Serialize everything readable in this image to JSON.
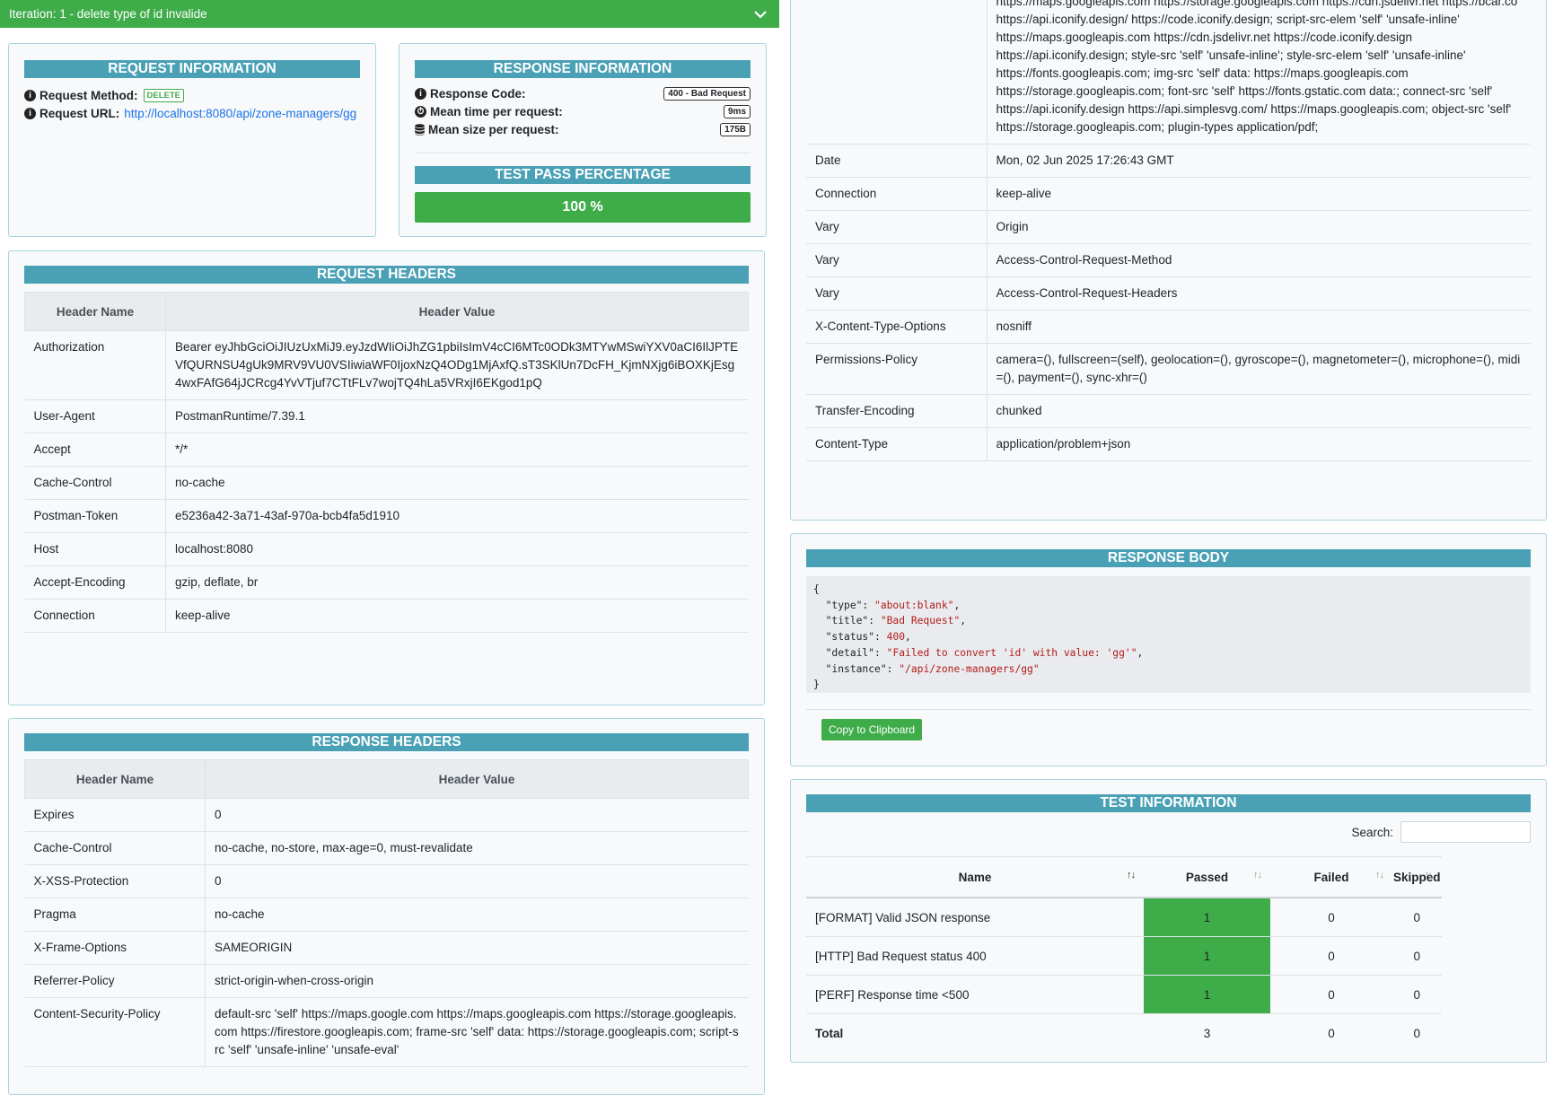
{
  "iteration": {
    "label": "Iteration: 1 - delete type of id invalide"
  },
  "request_info": {
    "title": "REQUEST INFORMATION",
    "method_label": "Request Method:",
    "method_value": "DELETE",
    "url_label": "Request URL:",
    "url_value": "http://localhost:8080/api/zone-managers/gg"
  },
  "response_info": {
    "title": "RESPONSE INFORMATION",
    "code_label": "Response Code:",
    "code_value": "400 - Bad Request",
    "time_label": "Mean time per request:",
    "time_value": "9ms",
    "size_label": "Mean size per request:",
    "size_value": "175B",
    "pass_title": "TEST PASS PERCENTAGE",
    "pass_value": "100 %",
    "pass_fraction": 1.0
  },
  "request_headers": {
    "title": "REQUEST HEADERS",
    "col_name": "Header Name",
    "col_value": "Header Value",
    "rows": [
      {
        "name": "Authorization",
        "value": "Bearer eyJhbGciOiJIUzUxMiJ9.eyJzdWIiOiJhZG1pbiIsImV4cCI6MTc0ODk3MTYwMSwiYXV0aCI6IlJPTEVfQURNSU4gUk9MRV9VU0VSIiwiaWF0IjoxNzQ4ODg1MjAxfQ.sT3SKlUn7DcFH_KjmNXjg6iBOXKjEsg4wxFAfG64jJCRcg4YvVTjuf7CTtFLv7wojTQ4hLa5VRxjI6EKgod1pQ"
      },
      {
        "name": "User-Agent",
        "value": "PostmanRuntime/7.39.1"
      },
      {
        "name": "Accept",
        "value": "*/*"
      },
      {
        "name": "Cache-Control",
        "value": "no-cache"
      },
      {
        "name": "Postman-Token",
        "value": "e5236a42-3a71-43af-970a-bcb4fa5d1910"
      },
      {
        "name": "Host",
        "value": "localhost:8080"
      },
      {
        "name": "Accept-Encoding",
        "value": "gzip, deflate, br"
      },
      {
        "name": "Connection",
        "value": "keep-alive"
      }
    ]
  },
  "response_headers": {
    "title": "RESPONSE HEADERS",
    "col_name": "Header Name",
    "col_value": "Header Value",
    "rows": [
      {
        "name": "Expires",
        "value": "0"
      },
      {
        "name": "Cache-Control",
        "value": "no-cache, no-store, max-age=0, must-revalidate"
      },
      {
        "name": "X-XSS-Protection",
        "value": "0"
      },
      {
        "name": "Pragma",
        "value": "no-cache"
      },
      {
        "name": "X-Frame-Options",
        "value": "SAMEORIGIN"
      },
      {
        "name": "Referrer-Policy",
        "value": "strict-origin-when-cross-origin"
      },
      {
        "name": "Content-Security-Policy",
        "value": "default-src 'self' https://maps.google.com https://maps.googleapis.com https://storage.googleapis.com https://firestore.googleapis.com; frame-src 'self' data: https://storage.googleapis.com; script-src 'self' 'unsafe-inline' 'unsafe-eval'"
      }
    ],
    "csp_top_value": "https://maps.googleapis.com https://storage.googleapis.com https://cdn.jsdelivr.net https://bcar.co https://api.iconify.design/ https://code.iconify.design; script-src-elem 'self' 'unsafe-inline' https://maps.googleapis.com https://cdn.jsdelivr.net https://code.iconify.design https://api.iconify.design; style-src 'self' 'unsafe-inline'; style-src-elem 'self' 'unsafe-inline' https://fonts.googleapis.com; img-src 'self' data: https://maps.googleapis.com https://storage.googleapis.com; font-src 'self' https://fonts.gstatic.com data:; connect-src 'self' https://api.iconify.design https://api.simplesvg.com/ https://maps.googleapis.com; object-src 'self' https://storage.googleapis.com; plugin-types application/pdf;",
    "continued_rows": [
      {
        "name": "Date",
        "value": "Mon, 02 Jun 2025 17:26:43 GMT"
      },
      {
        "name": "Connection",
        "value": "keep-alive"
      },
      {
        "name": "Vary",
        "value": "Origin"
      },
      {
        "name": "Vary",
        "value": "Access-Control-Request-Method"
      },
      {
        "name": "Vary",
        "value": "Access-Control-Request-Headers"
      },
      {
        "name": "X-Content-Type-Options",
        "value": "nosniff"
      },
      {
        "name": "Permissions-Policy",
        "value": "camera=(), fullscreen=(self), geolocation=(), gyroscope=(), magnetometer=(), microphone=(), midi=(), payment=(), sync-xhr=()"
      },
      {
        "name": "Transfer-Encoding",
        "value": "chunked"
      },
      {
        "name": "Content-Type",
        "value": "application/problem+json"
      }
    ]
  },
  "response_body": {
    "title": "RESPONSE BODY",
    "lines": [
      {
        "text": "{"
      },
      {
        "indent": "  ",
        "key": "\"type\"",
        "sep": ": ",
        "val": "\"about:blank\"",
        "tail": ","
      },
      {
        "indent": "  ",
        "key": "\"title\"",
        "sep": ": ",
        "val": "\"Bad Request\"",
        "tail": ","
      },
      {
        "indent": "  ",
        "key": "\"status\"",
        "sep": ": ",
        "val": "400",
        "tail": ","
      },
      {
        "indent": "  ",
        "key": "\"detail\"",
        "sep": ": ",
        "val": "\"Failed to convert 'id' with value: 'gg'\"",
        "tail": ","
      },
      {
        "indent": "  ",
        "key": "\"instance\"",
        "sep": ": ",
        "val": "\"/api/zone-managers/gg\"",
        "tail": ""
      },
      {
        "text": "}"
      }
    ],
    "copy_label": "Copy to Clipboard"
  },
  "test_info": {
    "title": "TEST INFORMATION",
    "search_label": "Search:",
    "search_value": "",
    "columns": [
      "Name",
      "Passed",
      "Failed",
      "Skipped"
    ],
    "rows": [
      {
        "name": "[FORMAT] Valid JSON response",
        "passed": "1",
        "failed": "0",
        "skipped": "0"
      },
      {
        "name": "[HTTP] Bad Request status 400",
        "passed": "1",
        "failed": "0",
        "skipped": "0"
      },
      {
        "name": "[PERF] Response time <500",
        "passed": "1",
        "failed": "0",
        "skipped": "0"
      }
    ],
    "total": {
      "name": "Total",
      "passed": "3",
      "failed": "0",
      "skipped": "0"
    }
  },
  "colors": {
    "accent_green": "#3fac4a",
    "section_teal": "#4aa0b5",
    "link_blue": "#1a73e8"
  },
  "icons": {
    "info": "info-circle-icon",
    "timer": "stopwatch-icon",
    "database": "database-icon",
    "chevron": "chevron-down-icon"
  }
}
